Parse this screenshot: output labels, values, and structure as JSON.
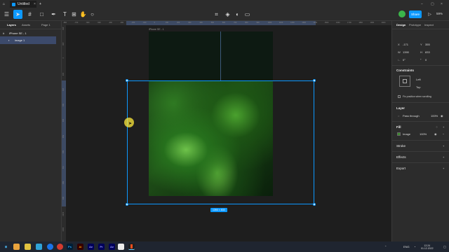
{
  "titlebar": {
    "home_icon": "home-icon",
    "tab_title": "Untitled",
    "add_tab": "+"
  },
  "toolbar": {
    "share_label": "Share",
    "zoom": "59%",
    "play_icon": "play-icon"
  },
  "left_panel": {
    "tabs": [
      "Layers",
      "Assets"
    ],
    "page": "Page 1",
    "frame_name": "iPhone SE - 1",
    "layer_name": "image 1"
  },
  "canvas": {
    "frame_label": "iPhone SE - 1",
    "size_badge": "1390 × 833",
    "ruler_h": [
      "-800",
      "-700",
      "-600",
      "-500",
      "-400",
      "-300",
      "-200",
      "-100",
      "0",
      "100",
      "200",
      "300",
      "400",
      "500",
      "600",
      "700",
      "800",
      "900",
      "1000",
      "1100",
      "1200",
      "1300",
      "1400",
      "1500",
      "1600",
      "1700",
      "1800",
      "1900",
      "2000"
    ],
    "ruler_v": [
      "-200",
      "-100",
      "0",
      "100",
      "200",
      "300",
      "400",
      "500",
      "600",
      "700",
      "800",
      "900",
      "1000",
      "1100"
    ]
  },
  "right_panel": {
    "tabs": [
      "Design",
      "Prototype",
      "Inspect"
    ],
    "x_label": "X",
    "x_value": "-171",
    "y_label": "Y",
    "y_value": "355",
    "w_label": "W",
    "w_value": "1390",
    "h_label": "H",
    "h_value": "833",
    "rotation": "0°",
    "radius": "0",
    "constraints_title": "Constraints",
    "constraint_h": "Left",
    "constraint_v": "Top",
    "fix_position": "Fix position when scrolling",
    "layer_title": "Layer",
    "blend_mode": "Pass through",
    "layer_opacity": "100%",
    "fill_title": "Fill",
    "fill_type": "Image",
    "fill_opacity": "100%",
    "stroke_title": "Stroke",
    "effects_title": "Effects",
    "export_title": "Export"
  },
  "taskbar": {
    "apps": [
      "Ps",
      "Ai",
      "Ae",
      "Pr",
      "Ae",
      "Pr"
    ],
    "lang": "ENG",
    "time": "12:24",
    "date": "01.12.2022"
  },
  "help": "?"
}
